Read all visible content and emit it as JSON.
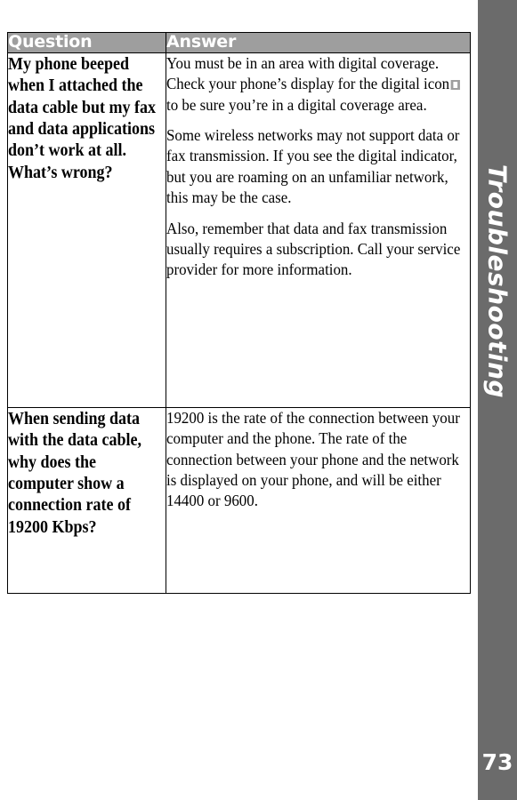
{
  "page": {
    "number": "73",
    "section_tab": "Troubleshooting",
    "tab_color": "#6b6b6b",
    "header_color": "#9e9e9e",
    "text_color": "#000000",
    "background": "#ffffff"
  },
  "table": {
    "columns": [
      {
        "key": "question",
        "header": "Question"
      },
      {
        "key": "answer",
        "header": "Answer"
      }
    ],
    "rows": [
      {
        "question": "My phone beeped when I attached the data cable but my fax and data applications don’t work at all. What’s wrong?",
        "answer_paragraphs": [
          {
            "before_icon": "You must be in an area with digital coverage. Check your phone’s display for the digital icon",
            "icon": "digital-coverage-icon",
            "after_icon": "to be sure you’re in a digital coverage area."
          },
          {
            "text": "Some wireless networks may not support data or fax transmission. If you see the digital indicator, but you are roaming on an unfamiliar network, this may be the case."
          },
          {
            "text": "Also, remember that data and fax transmission usually requires a subscription. Call your service provider for more information."
          }
        ]
      },
      {
        "question": "When sending data with the data cable, why does the computer show a connection rate of 19200 Kbps?",
        "answer_paragraphs": [
          {
            "text": "19200 is the rate of the connection between your computer and the phone. The rate of the connection between your phone and the network is displayed on your phone, and will be either 14400 or 9600."
          }
        ]
      }
    ]
  }
}
